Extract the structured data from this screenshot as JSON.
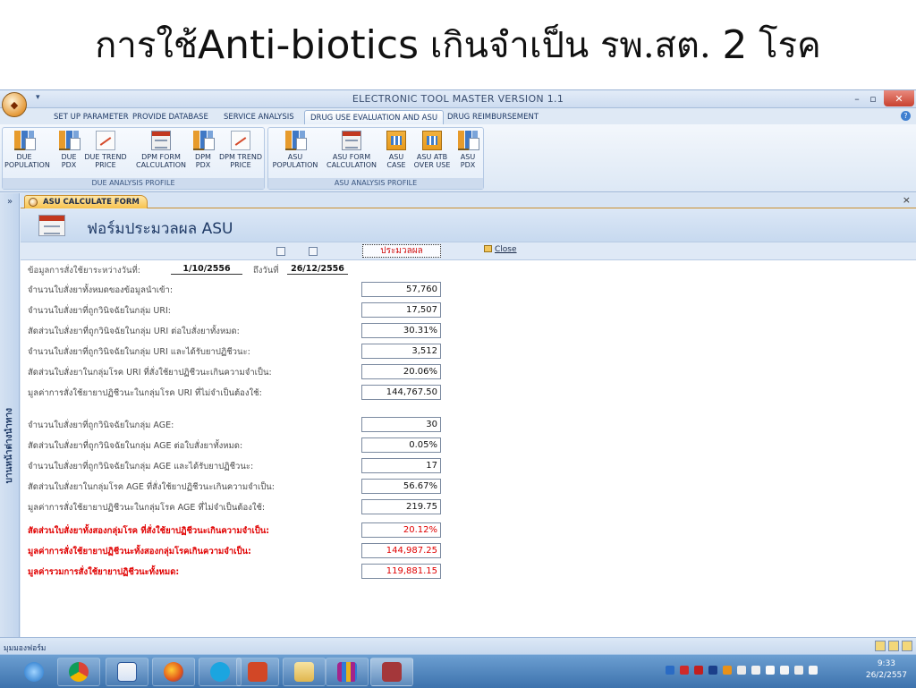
{
  "slide": {
    "title_pre": "การใช้",
    "title_latin": "Anti-biotics",
    "title_post": " เกินจำเป็น รพ.สต. ",
    "title_num": "2",
    "title_end": " โรค"
  },
  "window": {
    "title": "ELECTRONIC TOOL MASTER VERSION 1.1",
    "minimize": "–",
    "maximize": "▫",
    "close": "✕"
  },
  "tabs": [
    {
      "label": "SET UP PARAMETER"
    },
    {
      "label": "PROVIDE DATABASE"
    },
    {
      "label": "SERVICE ANALYSIS"
    },
    {
      "label": "DRUG USE EVALUATION AND ASU"
    },
    {
      "label": "DRUG REIMBURSEMENT"
    }
  ],
  "ribbon": {
    "due_group_label": "DUE ANALYSIS PROFILE",
    "asu_group_label": "ASU ANALYSIS PROFILE",
    "due_buttons": [
      {
        "line1": "DUE",
        "line2": "POPULATION"
      },
      {
        "line1": "DUE",
        "line2": "PDX"
      },
      {
        "line1": "DUE TREND",
        "line2": "PRICE"
      },
      {
        "line1": "DPM FORM",
        "line2": "CALCULATION"
      },
      {
        "line1": "DPM",
        "line2": "PDX"
      },
      {
        "line1": "DPM TREND",
        "line2": "PRICE"
      }
    ],
    "asu_buttons": [
      {
        "line1": "ASU",
        "line2": "POPULATION"
      },
      {
        "line1": "ASU FORM",
        "line2": "CALCULATION"
      },
      {
        "line1": "ASU",
        "line2": "CASE"
      },
      {
        "line1": "ASU ATB",
        "line2": "OVER USE"
      },
      {
        "line1": "ASU",
        "line2": "PDX"
      }
    ]
  },
  "nav": {
    "toggle": "»",
    "label": "บานหน้าต่างนำทาง"
  },
  "doc_tab": {
    "label": "ASU CALCULATE FORM",
    "close": "×"
  },
  "form": {
    "title": "ฟอร์มประมวลผล ASU",
    "process_button": "ประมวลผล",
    "close_button": "Close",
    "date_label_from": "ข้อมูลการสั่งใช้ยาระหว่างวันที่:",
    "date_from": "1/10/2556",
    "date_label_to": "ถึงวันที่",
    "date_to": "26/12/2556",
    "rows": [
      {
        "label": "จำนวนใบสั่งยาทั้งหมดของข้อมูลนำเข้า:",
        "value": "57,760"
      },
      {
        "label": "จำนวนใบสั่งยาที่ถูกวินิจฉัยในกลุ่ม URI:",
        "value": "17,507"
      },
      {
        "label": "สัดส่วนใบสั่งยาที่ถูกวินิจฉัยในกลุ่ม URI ต่อใบสั่งยาทั้งหมด:",
        "value": "30.31%"
      },
      {
        "label": "จำนวนใบสั่งยาที่ถูกวินิจฉัยในกลุ่ม URI และได้รับยาปฏิชีวนะ:",
        "value": "3,512"
      },
      {
        "label": "สัดส่วนใบสั่งยาในกลุ่มโรค URI ที่สั่งใช้ยาปฏิชีวนะเกินความจำเป็น:",
        "value": "20.06%"
      },
      {
        "label": "มูลค่าการสั่งใช้ยายาปฏิชีวนะในกลุ่มโรค URI ที่ไม่จำเป็นต้องใช้:",
        "value": "144,767.50"
      },
      {
        "label": "จำนวนใบสั่งยาที่ถูกวินิจฉัยในกลุ่ม AGE:",
        "value": "30"
      },
      {
        "label": "สัดส่วนใบสั่งยาที่ถูกวินิจฉัยในกลุ่ม AGE ต่อใบสั่งยาทั้งหมด:",
        "value": "0.05%"
      },
      {
        "label": "จำนวนใบสั่งยาที่ถูกวินิจฉัยในกลุ่ม AGE และได้รับยาปฏิชีวนะ:",
        "value": "17"
      },
      {
        "label": "สัดส่วนใบสั่งยาในกลุ่มโรค AGE ที่สั่งใช้ยาปฏิชีวนะเกินความจำเป็น:",
        "value": "56.67%"
      },
      {
        "label": "มูลค่าการสั่งใช้ยายาปฏิชีวนะในกลุ่มโรค AGE ที่ไม่จำเป็นต้องใช้:",
        "value": "219.75"
      },
      {
        "label": "สัดส่วนใบสั่งยาทั้งสองกลุ่มโรค ที่สั่งใช้ยาปฏิชีวนะเกินความจำเป็น:",
        "value": "20.12%"
      },
      {
        "label": "มูลค่าการสั่งใช้ยายาปฏิชีวนะทั้งสองกลุ่มโรคเกินความจำเป็น:",
        "value": "144,987.25"
      },
      {
        "label": "มูลค่ารวมการสั่งใช้ยายาปฏิชีวนะทั้งหมด:",
        "value": "119,881.15"
      }
    ]
  },
  "status": {
    "text": "มุมมองฟอร์ม"
  },
  "taskbar": {
    "time": "9:33",
    "date": "26/2/2557"
  },
  "colors": {
    "highlight_red": "#e00000",
    "ribbon_blue": "#dfe9f5"
  }
}
